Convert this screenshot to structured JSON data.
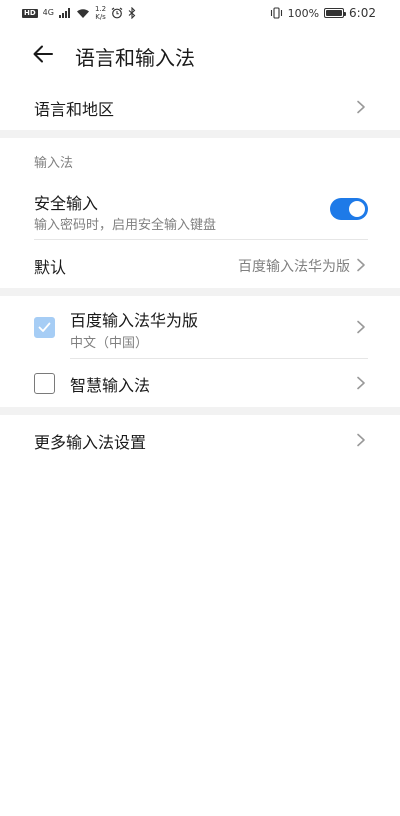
{
  "status_bar": {
    "hd": "HD",
    "network": "4G",
    "speed_value": "1.2",
    "speed_unit": "K/s",
    "battery": "100%",
    "time": "6:02",
    "icons": [
      "signal-icon",
      "wifi-icon",
      "alarm-icon",
      "bluetooth-icon",
      "vibrate-icon",
      "battery-icon"
    ]
  },
  "header": {
    "title": "语言和输入法"
  },
  "language_region": {
    "label": "语言和地区"
  },
  "input_method_section": {
    "label": "输入法",
    "secure_input": {
      "label": "安全输入",
      "description": "输入密码时，启用安全输入键盘",
      "enabled": true
    },
    "default": {
      "label": "默认",
      "value": "百度输入法华为版"
    }
  },
  "input_methods": [
    {
      "name": "百度输入法华为版",
      "subtitle": "中文（中国）",
      "checked": true
    },
    {
      "name": "智慧输入法",
      "subtitle": "",
      "checked": false
    }
  ],
  "more_settings": {
    "label": "更多输入法设置"
  },
  "colors": {
    "accent": "#1e7ae8",
    "checkbox_checked": "#a6cdf5",
    "secondary_text": "#808080",
    "section_gap": "#f2f2f2"
  }
}
